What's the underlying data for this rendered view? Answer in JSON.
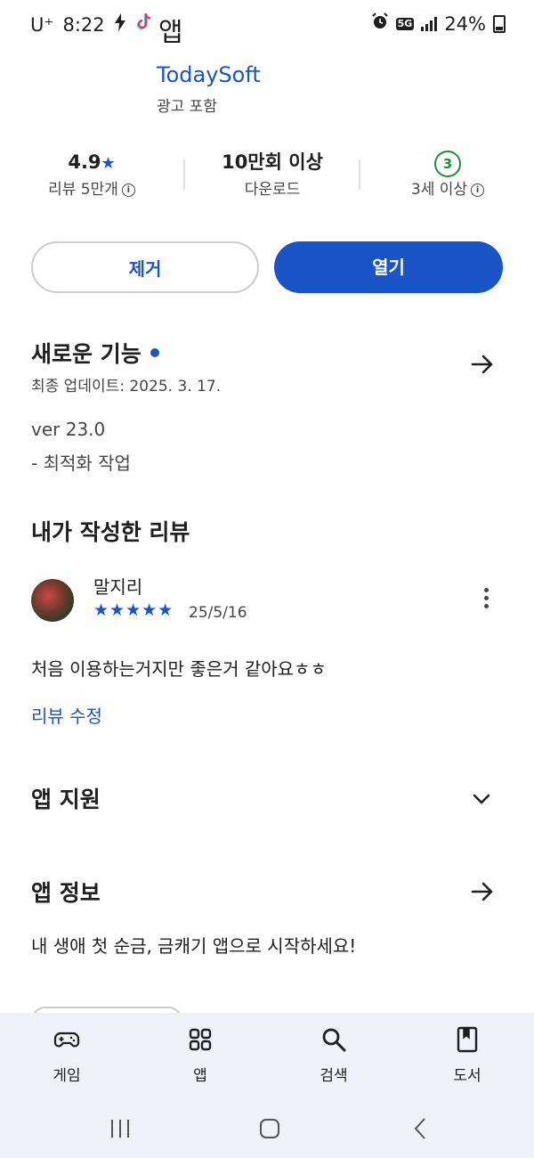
{
  "status_bar": {
    "carrier": "U⁺",
    "time": "8:22",
    "network": "5G",
    "battery": "24%"
  },
  "app": {
    "name_fragment": "앱",
    "developer": "TodaySoft",
    "ads_label": "광고 포함"
  },
  "stats": {
    "rating": "4.9★",
    "reviews_label": "리뷰 5만개",
    "downloads": "10만회 이상",
    "downloads_label": "다운로드",
    "age_badge": "3",
    "age_label": "3세 이상"
  },
  "actions": {
    "remove": "제거",
    "open": "열기"
  },
  "whats_new": {
    "title": "새로운 기능",
    "updated": "최종 업데이트: 2025. 3. 17.",
    "version": "ver 23.0",
    "note": "- 최적화 작업"
  },
  "my_review": {
    "title": "내가 작성한 리뷰",
    "author": "말지리",
    "stars": "★★★★★",
    "rating": 5,
    "date": "25/5/16",
    "text": "처음 이용하는거지만 좋은거 같아요ㅎㅎ",
    "edit_label": "리뷰 수정"
  },
  "app_support": {
    "title": "앱 지원"
  },
  "app_info": {
    "title": "앱 정보",
    "description": "내 생애 첫 순금, 금캐기 앱으로 시작하세요!"
  },
  "bottom_nav": {
    "items": [
      {
        "label": "게임",
        "icon": "gamepad-icon"
      },
      {
        "label": "앱",
        "icon": "apps-grid-icon"
      },
      {
        "label": "검색",
        "icon": "search-icon"
      },
      {
        "label": "도서",
        "icon": "book-icon"
      }
    ]
  },
  "colors": {
    "accent": "#1a55c7",
    "age_green": "#1e8e3e",
    "nav_bg": "#eff2f9"
  }
}
